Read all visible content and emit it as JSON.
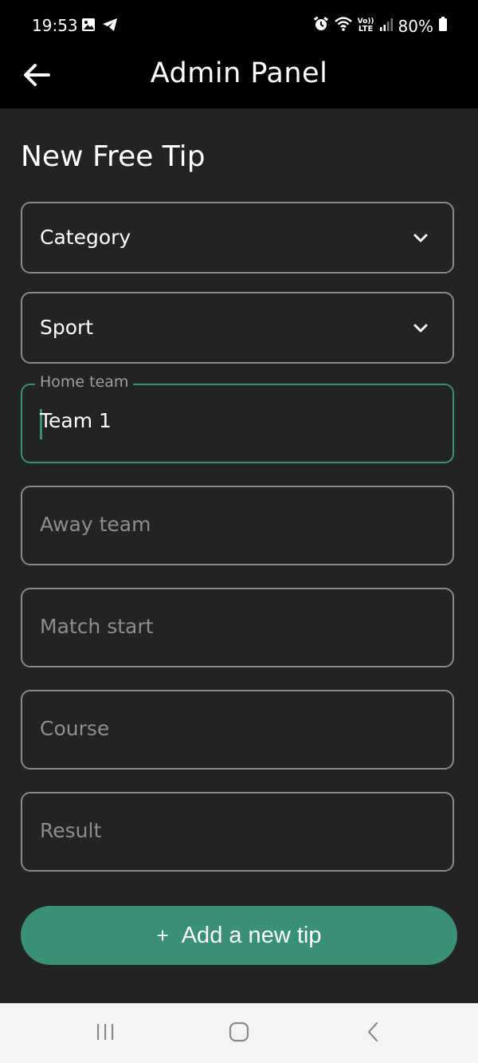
{
  "status": {
    "time": "19:53",
    "lte": "LTE",
    "battery": "80%"
  },
  "app_bar": {
    "title": "Admin Panel"
  },
  "form": {
    "heading": "New Free Tip",
    "category": {
      "value": "Category"
    },
    "sport": {
      "value": "Sport"
    },
    "home_team": {
      "label": "Home team",
      "value": "Team 1"
    },
    "away_team": {
      "placeholder": "Away team"
    },
    "match_start": {
      "placeholder": "Match start"
    },
    "course": {
      "placeholder": "Course"
    },
    "result": {
      "placeholder": "Result"
    },
    "submit": {
      "icon": "+",
      "label": "Add a new tip"
    }
  },
  "icons": {
    "status_left": [
      "image-icon",
      "telegram-icon"
    ],
    "status_right": [
      "alarm-icon",
      "wifi-icon",
      "volte-icon",
      "signal-icon",
      "battery-icon"
    ],
    "dropdown": "chevron-down-icon",
    "back": "arrow-left-icon",
    "nav": [
      "recent-apps-icon",
      "home-icon",
      "back-icon"
    ]
  },
  "colors": {
    "accent": "#3a8f78",
    "background": "#232323",
    "field_border": "#8a8a8a",
    "placeholder": "#8d8d8d"
  }
}
